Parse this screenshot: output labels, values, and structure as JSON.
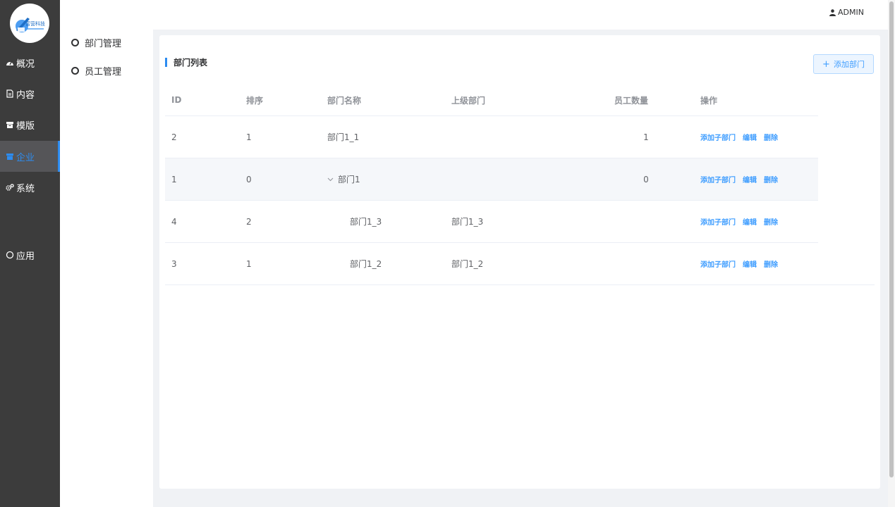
{
  "brand": {
    "logo_text": "富营科技"
  },
  "nav": {
    "items": [
      {
        "label": "概况",
        "icon": "dashboard-icon"
      },
      {
        "label": "内容",
        "icon": "document-icon"
      },
      {
        "label": "模版",
        "icon": "archive-icon"
      },
      {
        "label": "企业",
        "icon": "building-icon",
        "active": true
      },
      {
        "label": "系统",
        "icon": "gear-icon"
      },
      {
        "label": "应用",
        "icon": "circle-icon"
      }
    ]
  },
  "subnav": {
    "items": [
      {
        "label": "部门管理"
      },
      {
        "label": "员工管理"
      }
    ]
  },
  "header": {
    "user": "ADMIN"
  },
  "card": {
    "title": "部门列表",
    "add_button": "添加部门"
  },
  "table": {
    "columns": [
      "ID",
      "排序",
      "部门名称",
      "上级部门",
      "员工数量",
      "操作"
    ],
    "actions": [
      "添加子部门",
      "编辑",
      "删除"
    ],
    "rows": [
      {
        "id": "2",
        "sort": "1",
        "name": "部门1_1",
        "parent": "",
        "count": "1"
      },
      {
        "id": "1",
        "sort": "0",
        "name": "部门1",
        "parent": "",
        "count": "0",
        "expanded": true
      },
      {
        "id": "4",
        "sort": "2",
        "name": "部门1_3",
        "parent": "部门1_3",
        "count": ""
      },
      {
        "id": "3",
        "sort": "1",
        "name": "部门1_2",
        "parent": "部门1_2",
        "count": ""
      }
    ]
  },
  "colors": {
    "accent": "#2d8cf0",
    "link": "#409eff",
    "nav_bg": "#3c3c3c"
  }
}
